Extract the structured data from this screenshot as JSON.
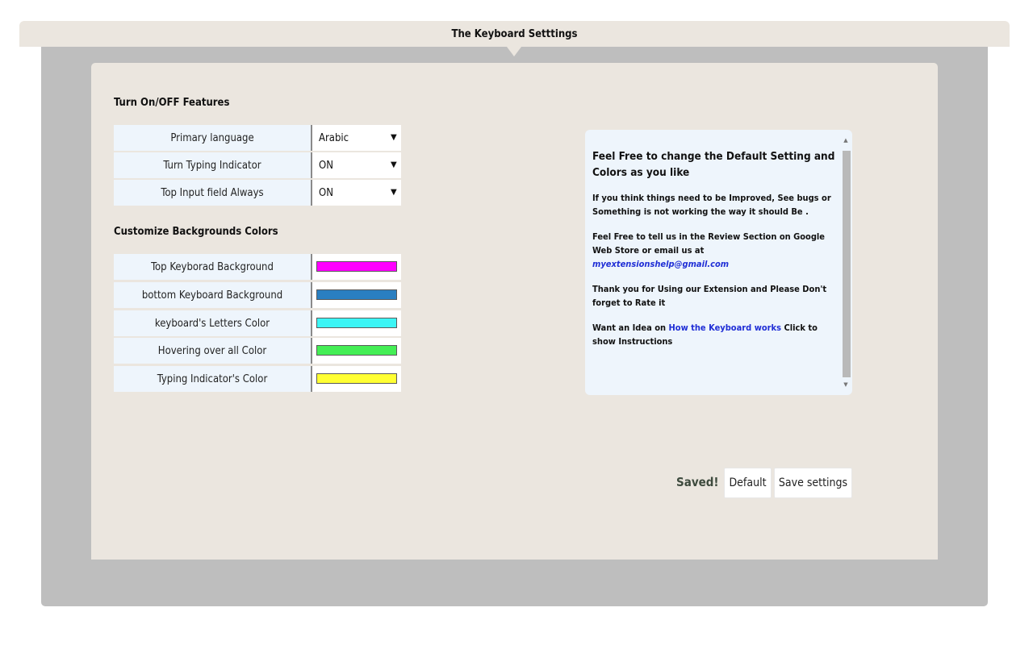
{
  "page": {
    "title": "The Keyboard Setttings"
  },
  "features": {
    "title": "Turn On/OFF Features",
    "rows": [
      {
        "label": "Primary language",
        "value": "Arabic"
      },
      {
        "label": "Turn Typing Indicator",
        "value": "ON"
      },
      {
        "label": "Top Input field Always",
        "value": "ON"
      }
    ]
  },
  "colors": {
    "title": "Customize Backgrounds Colors",
    "rows": [
      {
        "label": "Top Keyborad Background",
        "color": "#ff00ff"
      },
      {
        "label": "bottom Keyboard Background",
        "color": "#2a7fc1"
      },
      {
        "label": "keyboard's Letters Color",
        "color": "#3cf5f5"
      },
      {
        "label": "Hovering over all Color",
        "color": "#44ee55"
      },
      {
        "label": "Typing Indicator's Color",
        "color": "#ffff33"
      }
    ]
  },
  "info": {
    "heading": "Feel Free to change the Default Setting and Colors as you like",
    "p1": "If you think things need to be Improved, See bugs or Something is not working the way it should Be .",
    "p2_prefix": "Feel Free to tell us in the Review Section on Google Web Store or email us at ",
    "p2_email": "myextensionshelp@gmail.com",
    "p3": "Thank you for Using our Extension and Please Don't forget to Rate it",
    "p4_prefix": "Want an Idea on ",
    "p4_link": "How the Keyboard works",
    "p4_suffix": " Click to show Instructions"
  },
  "footer": {
    "status": "Saved!",
    "default_label": "Default",
    "save_label": "Save settings"
  },
  "icons": {
    "dropdown": "▼",
    "scroll_up": "▲",
    "scroll_down": "▼"
  }
}
